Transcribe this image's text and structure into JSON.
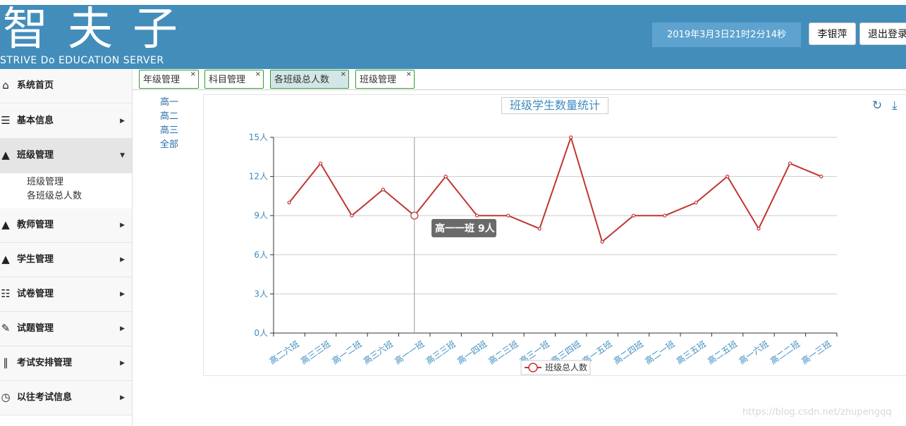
{
  "header": {
    "logo_text": "智夫子",
    "logo_subtitle": "STRIVE Do EDUCATION SERVER",
    "datetime": "2019年3月3日21时2分14秒",
    "user_button": "李银萍",
    "logout_button": "退出登录"
  },
  "sidebar": {
    "items": [
      {
        "label": "系统首页",
        "icon": "home-icon",
        "glyph": "⌂"
      },
      {
        "label": "基本信息",
        "icon": "id-card-icon",
        "glyph": "☰"
      },
      {
        "label": "班级管理",
        "icon": "class-user-icon",
        "glyph": "▲"
      },
      {
        "label": "教师管理",
        "icon": "teacher-icon",
        "glyph": "▲"
      },
      {
        "label": "学生管理",
        "icon": "student-icon",
        "glyph": "▲"
      },
      {
        "label": "试卷管理",
        "icon": "paper-icon",
        "glyph": "☷"
      },
      {
        "label": "试题管理",
        "icon": "question-icon",
        "glyph": "✎"
      },
      {
        "label": "考试安排管理",
        "icon": "books-icon",
        "glyph": "∥"
      },
      {
        "label": "以往考试信息",
        "icon": "clock-icon",
        "glyph": "◷"
      }
    ],
    "submenu": [
      "班级管理",
      "各班级总人数"
    ]
  },
  "tabs": [
    {
      "label": "年级管理"
    },
    {
      "label": "科目管理"
    },
    {
      "label": "各班级总人数"
    },
    {
      "label": "班级管理"
    }
  ],
  "grades": [
    "高一",
    "高二",
    "高三",
    "全部"
  ],
  "tooltip": {
    "text": "高一一班 9人"
  },
  "watermark": "https://blog.csdn.net/zhupengqq",
  "colors": {
    "header": "#438dbb",
    "line": "#c23531",
    "axis": "#3f8cc0"
  },
  "chart_data": {
    "type": "line",
    "title": "班级学生数量统计",
    "categories": [
      "高二六班",
      "高三三班",
      "高一二班",
      "高三六班",
      "高一一班",
      "高三三班",
      "高一四班",
      "高二三班",
      "高三一班",
      "高三四班",
      "高一五班",
      "高二四班",
      "高二一班",
      "高三五班",
      "高二五班",
      "高一六班",
      "高二二班",
      "高一三班"
    ],
    "series": [
      {
        "name": "班级总人数",
        "values": [
          10,
          13,
          9,
          11,
          9,
          12,
          9,
          9,
          8,
          15,
          7,
          9,
          9,
          10,
          12,
          8,
          13,
          12
        ]
      }
    ],
    "ylim": [
      0,
      15
    ],
    "yticks": [
      "0人",
      "3人",
      "6人",
      "9人",
      "12人",
      "15人"
    ],
    "ytick_values": [
      0,
      3,
      6,
      9,
      12,
      15
    ],
    "grid": true,
    "legend": "bottom-center",
    "highlight_index": 4
  }
}
